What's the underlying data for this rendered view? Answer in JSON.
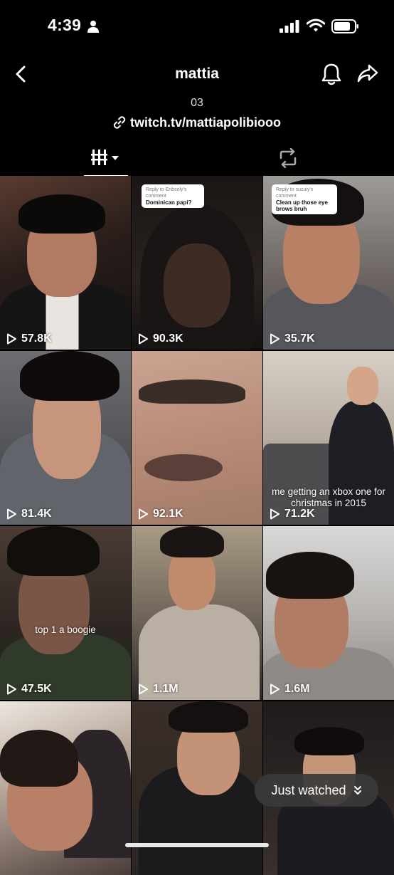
{
  "status_bar": {
    "time": "4:39"
  },
  "header": {
    "title": "mattia",
    "bio": "03",
    "link": "twitch.tv/mattiapolibiooo"
  },
  "tabs": [
    {
      "name": "videos"
    },
    {
      "name": "reposts"
    }
  ],
  "videos": [
    {
      "views": "57.8K",
      "caption": "",
      "reply_to": "",
      "reply_text": ""
    },
    {
      "views": "90.3K",
      "caption": "",
      "reply_to": "Reply to Enbsoly's comment",
      "reply_text": "Dominican papi?"
    },
    {
      "views": "35.7K",
      "caption": "",
      "reply_to": "Reply to sucuiy's comment",
      "reply_text": "Clean up those eye brows bruh"
    },
    {
      "views": "81.4K",
      "caption": "",
      "reply_to": "",
      "reply_text": ""
    },
    {
      "views": "92.1K",
      "caption": "",
      "reply_to": "",
      "reply_text": ""
    },
    {
      "views": "71.2K",
      "caption": "me getting an xbox one for christmas in 2015",
      "reply_to": "",
      "reply_text": ""
    },
    {
      "views": "47.5K",
      "caption": "top 1 a boogie",
      "reply_to": "",
      "reply_text": ""
    },
    {
      "views": "1.1M",
      "caption": "",
      "reply_to": "",
      "reply_text": ""
    },
    {
      "views": "1.6M",
      "caption": "",
      "reply_to": "",
      "reply_text": ""
    },
    {
      "views": "",
      "caption": "",
      "reply_to": "",
      "reply_text": ""
    },
    {
      "views": "",
      "caption": "",
      "reply_to": "",
      "reply_text": ""
    },
    {
      "views": "",
      "caption": "",
      "reply_to": "",
      "reply_text": ""
    }
  ],
  "just_watched": {
    "label": "Just watched"
  },
  "colors": {
    "background": "#000000",
    "pill": "#3a3a3a",
    "text": "#ffffff"
  }
}
